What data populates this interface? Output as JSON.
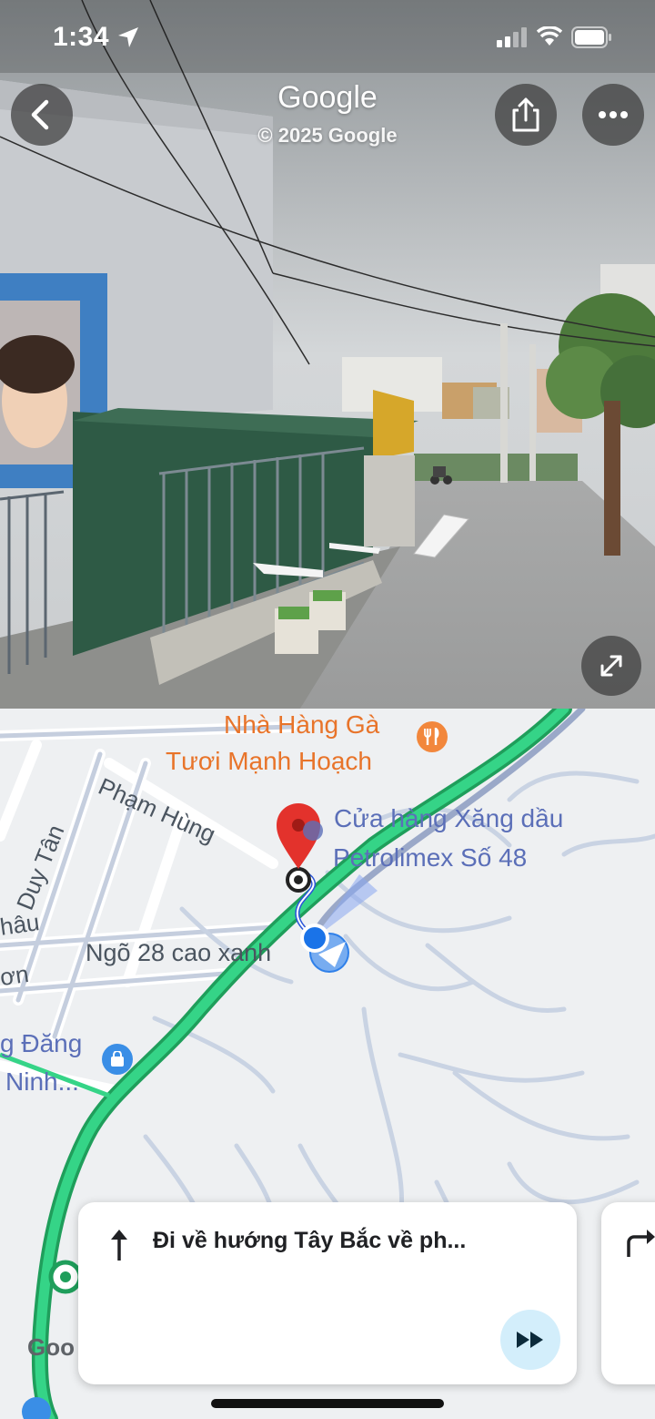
{
  "status_bar": {
    "time": "1:34",
    "icons": [
      "location-arrow-icon",
      "cellular-signal-icon",
      "wifi-icon",
      "battery-icon"
    ]
  },
  "street_view": {
    "title": "Google",
    "copyright": "© 2025 Google",
    "buttons": {
      "back": "back-chevron-icon",
      "share": "share-icon",
      "more": "more-dots-icon",
      "expand": "expand-icon"
    }
  },
  "map": {
    "labels": {
      "restaurant_line1": "Nhà Hàng Gà",
      "restaurant_line2": "Tươi Mạnh Hoạch",
      "gas_station_line1": "Cửa hàng Xăng dầu",
      "gas_station_line2": "Petrolimex Số 48",
      "alley": "Ngõ 28 cao xanh",
      "street_pham_hung": "Phạm Hùng",
      "street_duy_tan": "Duy Tân",
      "fragment_hau": "hâu",
      "fragment_on": "ơn",
      "shop_line1": "g Đăng",
      "shop_line2": "Ninh...",
      "google_watermark": "Goo"
    },
    "colors": {
      "route_green": "#2fd07c",
      "route_blue": "#2a55d8",
      "destination_pin": "#e3322c",
      "location_dot": "#1a73e8"
    }
  },
  "directions": {
    "current_step": "Đi về hướng Tây Bắc về ph...",
    "current_icon": "straight-arrow-icon",
    "next_icon": "turn-right-icon",
    "fast_forward_icon": "fast-forward-icon"
  }
}
